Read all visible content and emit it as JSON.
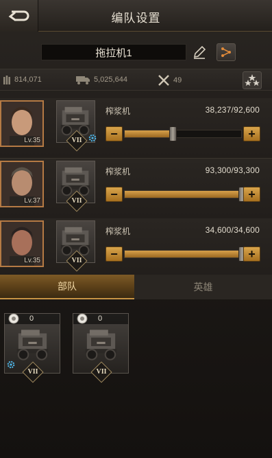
{
  "header": {
    "title": "编队设置"
  },
  "squad": {
    "name": "拖拉机1"
  },
  "stats": {
    "ammo": "814,071",
    "load": "5,025,644",
    "tools": "49"
  },
  "heroes": [
    {
      "level": "Lv.35",
      "unit_name": "榨浆机",
      "count": "38,237/92,600",
      "rank": "VII",
      "fill": 0.41,
      "gear": true
    },
    {
      "level": "Lv.37",
      "unit_name": "榨浆机",
      "count": "93,300/93,300",
      "rank": "VII",
      "fill": 1.0,
      "gear": false
    },
    {
      "level": "Lv.35",
      "unit_name": "榨浆机",
      "count": "34,600/34,600",
      "rank": "VII",
      "fill": 1.0,
      "gear": false
    }
  ],
  "controls": {
    "minus": "−",
    "plus": "+"
  },
  "tabs": [
    {
      "label": "部队"
    },
    {
      "label": "英雄"
    }
  ],
  "troops": [
    {
      "count": "0",
      "rank": "VII",
      "gear": true
    },
    {
      "count": "0",
      "rank": "VII",
      "gear": false
    }
  ],
  "colors": {
    "accent": "#c79445",
    "bar_fill": "#d7a14a",
    "portrait_border": "#b57a44"
  }
}
